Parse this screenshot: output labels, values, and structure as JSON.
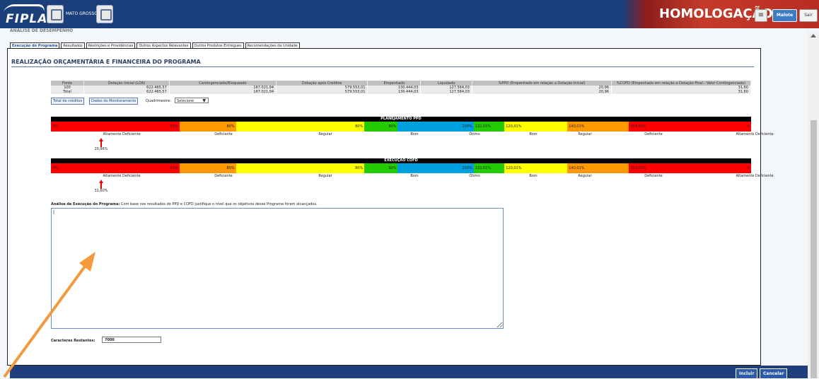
{
  "header": {
    "logo": "FIPLAN",
    "emblem_text": "MATO GROSSO",
    "env": "HOMOLOGAÇÃO",
    "menu_icon": "hamburger-icon",
    "malote": "Malote",
    "sair": "Sair"
  },
  "breadcrumb": "ANÁLISE DE DESEMPENHO",
  "tabs": [
    "Execução do Programa",
    "Resultados",
    "Restrições e Providências",
    "Outros Aspectos Relevantes",
    "Outros Produtos Entregues",
    "Recomendações da Unidade"
  ],
  "section_title": "REALIZAÇÃO ORÇAMENTÁRIA E FINANCEIRA DO PROGRAMA",
  "table": {
    "headers": [
      "Fonte",
      "Dotação Inicial (LOA)",
      "Contingenciado/Bloqueado",
      "Dotação após Créditos",
      "Empenhado",
      "Liquidado",
      "%PPD (Empenhado em relação a Dotação Inicial)",
      "%COFD (Empenhado em relação a Dotação Final - Valor Contingenciado)"
    ],
    "rows": [
      [
        "100",
        "622.465,57",
        "167.021,94",
        "579.553,01",
        "130.444,03",
        "127.564,03",
        "20,96",
        "31,60"
      ],
      [
        "Total",
        "622.465,57",
        "167.021,94",
        "579.553,01",
        "130.444,03",
        "127.564,03",
        "20,96",
        "31,60"
      ]
    ]
  },
  "buttons": {
    "creditos": "Total de créditos",
    "monitoramento": "Dados do Monitoramento",
    "quadrimestre_label": "Quadrimestre:",
    "quadrimestre_value": "Selecione"
  },
  "scales": [
    {
      "title": "PLANEJAMENTO PPD",
      "marker_value": "20,96%",
      "marker_percent": 20.96
    },
    {
      "title": "EXECUÇÃO COFD",
      "marker_value": "31,60%",
      "marker_percent": 31.6
    }
  ],
  "scale_segments": [
    {
      "color": "#ff0000",
      "left": "0%",
      "right": "50%"
    },
    {
      "color": "#ff9900",
      "left": "",
      "right": "80%"
    },
    {
      "color": "#ffff00",
      "left": "",
      "right": "80%"
    },
    {
      "color": "#22cc00",
      "left": "",
      "right": "90%"
    },
    {
      "color": "#00a0e0",
      "left": "",
      "right": "100%"
    },
    {
      "color": "#22cc00",
      "left": "110,01%",
      "right": ""
    },
    {
      "color": "#ffff00",
      "left": "120,01%",
      "right": ""
    },
    {
      "color": "#ff9900",
      "left": "140,01%",
      "right": ""
    },
    {
      "color": "#ff0000",
      "left": "150,01%",
      "right": "%"
    }
  ],
  "scale_labels": [
    "Altamente Deficiente",
    "Deficiente",
    "Regular",
    "Bom",
    "Ótimo",
    "Bom",
    "Regular",
    "Deficiente",
    "Altamente Deficiente"
  ],
  "analise": {
    "label": "Análise de Execução do Programa:",
    "hint": "Com base nos resultados do PPD e COFD justifique o nível que os objetivos desse Programa foram alcançados.",
    "text": "|"
  },
  "caracteres": {
    "label": "Caracteres Restantes:",
    "value": "7000"
  },
  "footer": {
    "incluir": "Incluir",
    "cancelar": "Cancelar"
  }
}
